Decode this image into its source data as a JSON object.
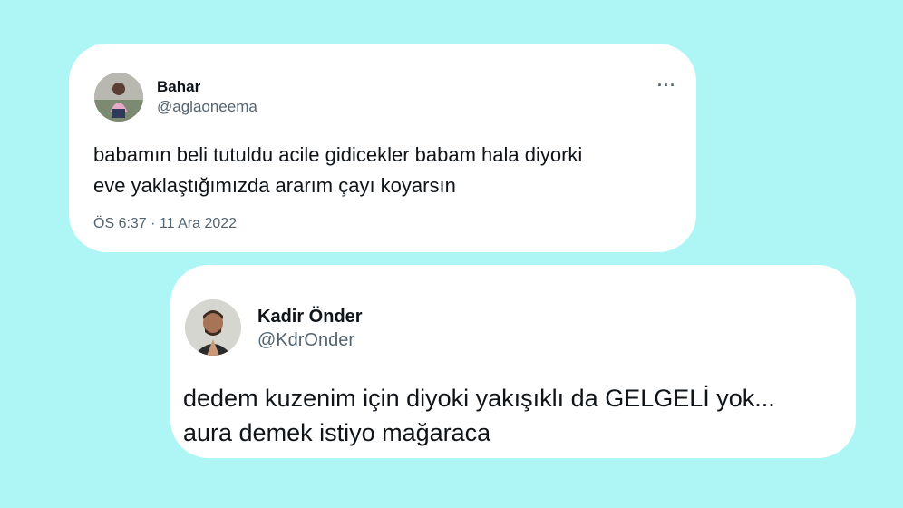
{
  "background_color": "#aef6f6",
  "tweets": [
    {
      "display_name": "Bahar",
      "handle": "@aglaoneema",
      "text": "babamın beli tutuldu acile gidicekler babam hala diyorki\neve yaklaştığımızda ararım çayı koyarsın",
      "timestamp": "ÖS 6:37 · 11 Ara 2022",
      "more_icon": "more-horizontal-icon",
      "more_label": "···"
    },
    {
      "display_name": "Kadir Önder",
      "handle": "@KdrOnder",
      "text": "dedem kuzenim için diyoki yakışıklı da GELGELİ yok...\naura demek istiyo mağaraca"
    }
  ]
}
